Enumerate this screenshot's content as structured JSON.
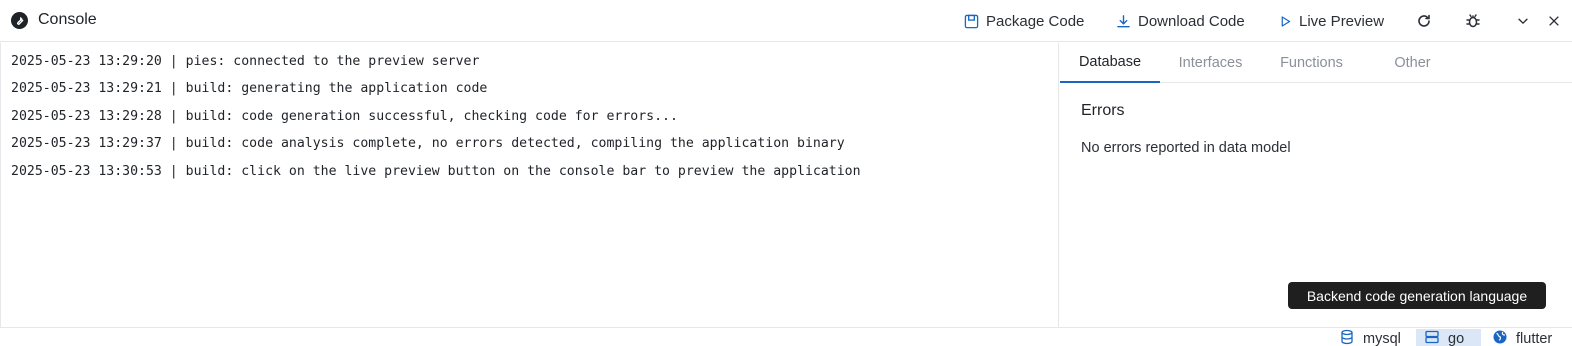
{
  "header": {
    "title": "Console",
    "actions": {
      "package_code": "Package Code",
      "download_code": "Download Code",
      "live_preview": "Live Preview"
    }
  },
  "console": {
    "lines": [
      "2025-05-23 13:29:20 | pies: connected to the preview server",
      "2025-05-23 13:29:21 | build: generating the application code",
      "2025-05-23 13:29:28 | build: code generation successful, checking code for errors...",
      "2025-05-23 13:29:37 | build: code analysis complete, no errors detected, compiling the application binary",
      "2025-05-23 13:30:53 | build: click on the live preview button on the console bar to preview the application"
    ]
  },
  "panel": {
    "tabs": [
      "Database",
      "Interfaces",
      "Functions",
      "Other"
    ],
    "active_tab": "Database",
    "errors_title": "Errors",
    "errors_message": "No errors reported in data model"
  },
  "tooltip": {
    "text": "Backend code generation language"
  },
  "statusbar": {
    "database": "mysql",
    "backend": "go",
    "frontend": "flutter"
  },
  "colors": {
    "accent": "#1a66c4",
    "tooltip_bg": "#1f1f1f",
    "active_status_bg": "#dbe7f6"
  }
}
